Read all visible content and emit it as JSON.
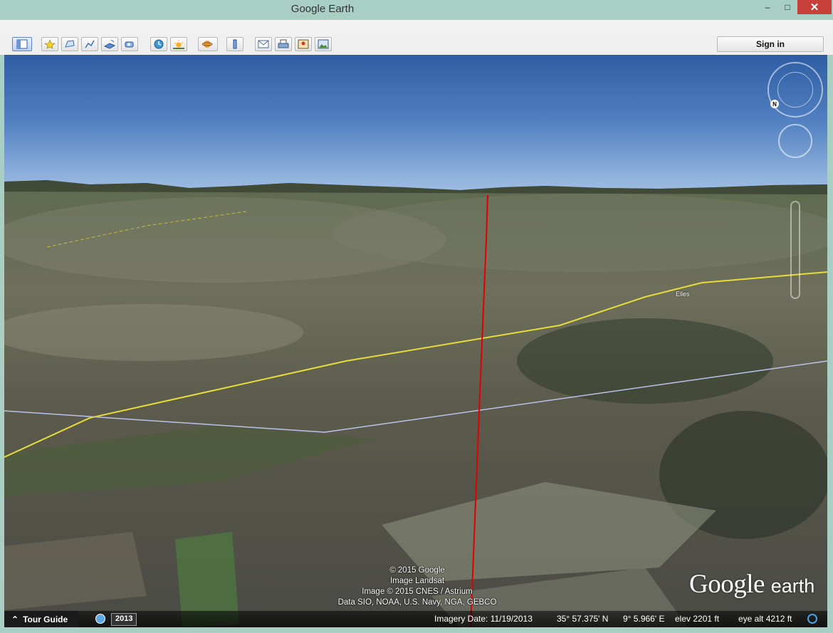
{
  "window": {
    "title": "Google Earth",
    "minimize_label": "–",
    "maximize_label": "□",
    "close_label": "✕"
  },
  "toolbar": {
    "buttons": [
      {
        "name": "sidebar-toggle",
        "icon": "sidebar-icon"
      },
      {
        "name": "add-placemark",
        "icon": "pushpin-icon"
      },
      {
        "name": "add-polygon",
        "icon": "polygon-icon"
      },
      {
        "name": "add-path",
        "icon": "path-icon"
      },
      {
        "name": "add-image-overlay",
        "icon": "image-overlay-icon"
      },
      {
        "name": "record-tour",
        "icon": "record-tour-icon"
      },
      {
        "name": "historical-imagery",
        "icon": "clock-icon"
      },
      {
        "name": "sunlight",
        "icon": "sun-icon"
      },
      {
        "name": "switch-planet",
        "icon": "planet-icon"
      },
      {
        "name": "ruler",
        "icon": "ruler-icon"
      },
      {
        "name": "email",
        "icon": "email-icon"
      },
      {
        "name": "print",
        "icon": "print-icon"
      },
      {
        "name": "view-in-maps",
        "icon": "maps-icon"
      },
      {
        "name": "save-image",
        "icon": "save-image-icon"
      }
    ],
    "sign_in_label": "Sign in"
  },
  "map": {
    "place_label": "Elles",
    "attribution": [
      "© 2015 Google",
      "Image Landsat",
      "Image © 2015 CNES / Astrium",
      "Data SIO, NOAA, U.S. Navy, NGA, GEBCO"
    ],
    "logo_main": "Google",
    "logo_sub": "earth",
    "north_label": "N"
  },
  "status": {
    "tour_guide_label": "Tour Guide",
    "year": "2013",
    "imagery_date": "Imagery Date: 11/19/2013",
    "latitude": "35° 57.375' N",
    "longitude": "9° 5.966' E",
    "elevation": "elev   2201 ft",
    "eye_alt": "eye alt   4212 ft"
  }
}
